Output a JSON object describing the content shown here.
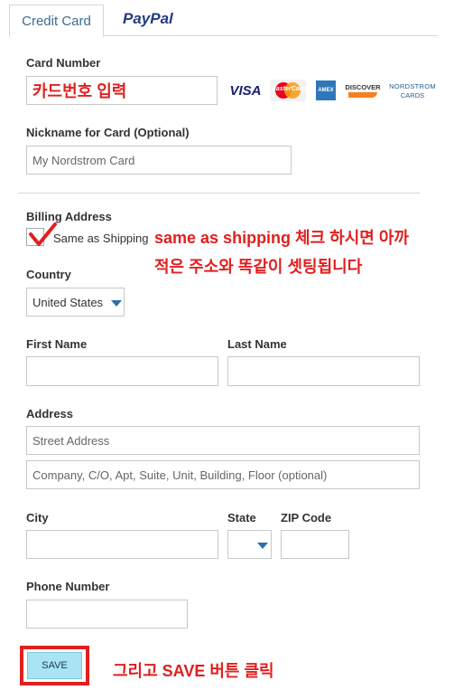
{
  "tabs": [
    {
      "label": "Credit Card"
    },
    {
      "label": "PayPal"
    }
  ],
  "card_number": {
    "label": "Card Number",
    "value": "카드번호 입력"
  },
  "card_logos": [
    {
      "text": "VISA",
      "color": "#1a1f71"
    },
    {
      "text": "MasterCard",
      "color": "#eb001b"
    },
    {
      "text": "AMEX",
      "color": "#2e77bb"
    },
    {
      "text": "DISCOVER",
      "color": "#f48120"
    },
    {
      "text": "NORDSTROM",
      "text2": "CARDS",
      "color": "#1f5f8b"
    }
  ],
  "nickname": {
    "label": "Nickname for Card (Optional)",
    "placeholder": "My Nordstrom Card"
  },
  "billing": {
    "label": "Billing Address",
    "checkbox_label": "Same as Shipping"
  },
  "annotation_1": {
    "line1": "same as shipping 체크 하시면 아까",
    "line2": "적은 주소와 똑같이 셋팅됩니다"
  },
  "country": {
    "label": "Country",
    "value": "United States"
  },
  "first_name": {
    "label": "First Name"
  },
  "last_name": {
    "label": "Last Name"
  },
  "address": {
    "label": "Address",
    "placeholder1": "Street Address",
    "placeholder2": "Company, C/O, Apt, Suite, Unit, Building, Floor (optional)"
  },
  "city": {
    "label": "City"
  },
  "state": {
    "label": "State"
  },
  "zip": {
    "label": "ZIP Code"
  },
  "phone": {
    "label": "Phone Number"
  },
  "save": {
    "label": "SAVE"
  },
  "annotation_2": {
    "text": "그리고 SAVE 버튼 클릭"
  },
  "colors": {
    "accent": "#2a6fb0",
    "annotation": "#e0201f",
    "save_bg": "#a8e4f3"
  }
}
